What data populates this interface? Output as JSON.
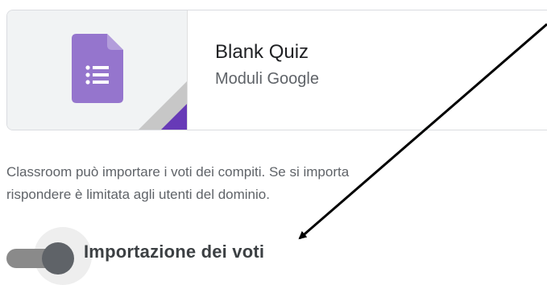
{
  "attachment": {
    "title": "Blank Quiz",
    "subtitle": "Moduli Google",
    "icon": "google-forms-icon",
    "icon_color": "#9575cd",
    "corner_color": "#673ab7"
  },
  "description": {
    "line1": "Classroom può importare i voti dei compiti. Se si importa",
    "line2": "rispondere è limitata agli utenti del dominio."
  },
  "grade_import": {
    "label": "Importazione dei voti",
    "state": "off"
  },
  "annotation": {
    "icon": "arrow-icon",
    "color": "#000000"
  }
}
